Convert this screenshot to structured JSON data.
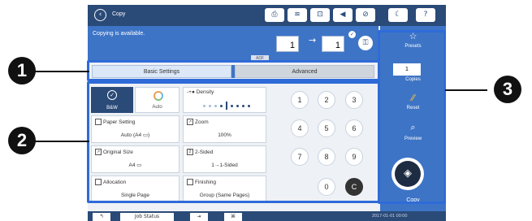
{
  "topbar": {
    "title": "Copy",
    "icons": [
      "back-icon",
      "printer-icon",
      "wifi-icon",
      "nfc-icon",
      "sound-icon",
      "no-wifi-icon",
      "sleep-icon",
      "help-icon"
    ]
  },
  "status": {
    "message": "Copying is available.",
    "originals": "1",
    "copies_out": "1",
    "adf_label": "ADF"
  },
  "tabs": {
    "basic": "Basic Settings",
    "advanced": "Advanced"
  },
  "color_mode": {
    "bw": "B&W",
    "auto": "Auto"
  },
  "density": {
    "label": "Density",
    "level_index": 4,
    "levels": 9
  },
  "settings": {
    "paper": {
      "title": "Paper Setting",
      "value": "Auto (A4 ▭)"
    },
    "zoom": {
      "title": "Zoom",
      "value": "100%"
    },
    "original_size": {
      "title": "Original Size",
      "value": "A4 ▭"
    },
    "two_sided": {
      "title": "2-Sided",
      "value": "1→1-Sided"
    },
    "allocation": {
      "title": "Allocation",
      "value": "Single Page"
    },
    "finishing": {
      "title": "Finishing",
      "value": "Group (Same Pages)"
    }
  },
  "keypad": [
    "1",
    "2",
    "3",
    "4",
    "5",
    "6",
    "7",
    "8",
    "9",
    "0",
    "C"
  ],
  "right_panel": {
    "presets": "Presets",
    "copies_value": "1",
    "copies_label": "Copies",
    "reset": "Reset",
    "preview": "Preview",
    "copy": "Copy"
  },
  "bottombar": {
    "job_status": "Job Status",
    "timestamp": "2017-01-01 00:00"
  },
  "callouts": [
    "1",
    "2",
    "3"
  ],
  "colors": {
    "accent": "#2f6bd8",
    "panel": "#3d74c6",
    "dark": "#2a4a78"
  }
}
